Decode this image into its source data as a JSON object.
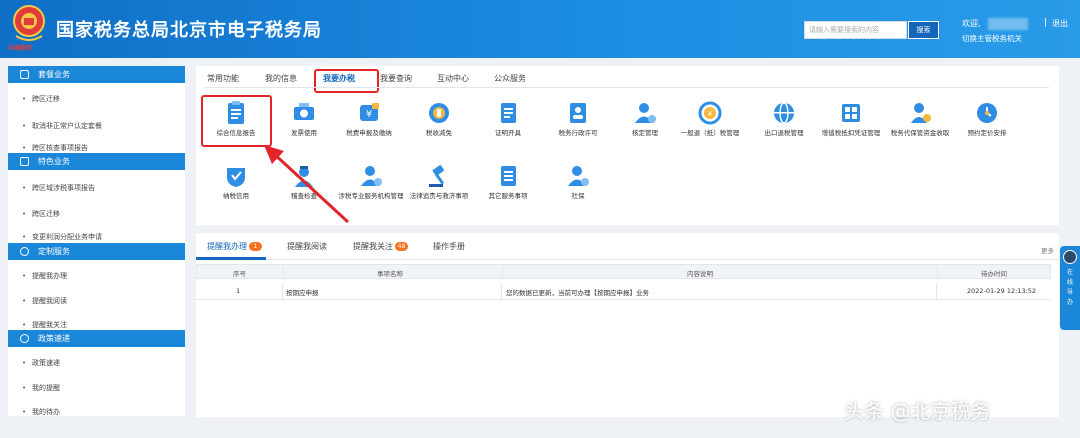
{
  "header": {
    "site_title": "国家税务总局北京市电子税务局",
    "emblem_caption": "中国税务",
    "search_placeholder": "请输入需要搜索的内容",
    "search_button": "搜索",
    "welcome": "欢迎,",
    "switch_label": "切换主管税务机关",
    "separator": "|",
    "logout": "退出"
  },
  "sidebar": {
    "sections": [
      {
        "title": "套餐业务",
        "items": [
          "跨区迁移",
          "取消非正常户认定套餐",
          "跨区核查事项报告"
        ]
      },
      {
        "title": "特色业务",
        "items": [
          "跨区域涉税事项报告",
          "跨区迁移",
          "变更利润分配业务申请"
        ]
      },
      {
        "title": "定制服务",
        "items": [
          "提醒我办理",
          "提醒我阅读",
          "提醒我关注"
        ]
      },
      {
        "title": "政策速递",
        "items": [
          "政策速递",
          "我的提醒",
          "我的待办"
        ]
      }
    ]
  },
  "main_tabs": [
    "常用功能",
    "我的信息",
    "我要办税",
    "我要查询",
    "互动中心",
    "公众服务"
  ],
  "active_tab": "我要办税",
  "tiles_row1": [
    {
      "label": "综合信息报告",
      "icon": "clipboard-icon"
    },
    {
      "label": "发票使用",
      "icon": "ticket-icon"
    },
    {
      "label": "税费申报及缴纳",
      "icon": "yuan-icon"
    },
    {
      "label": "税收减免",
      "icon": "coin-icon"
    },
    {
      "label": "证明开具",
      "icon": "document-icon"
    },
    {
      "label": "税务行政许可",
      "icon": "person-card-icon"
    },
    {
      "label": "核定管理",
      "icon": "user-settings-icon"
    },
    {
      "label": "一般退（抵）税管理",
      "icon": "refund-icon"
    },
    {
      "label": "出口退税管理",
      "icon": "globe-icon"
    },
    {
      "label": "增值税抵扣凭证管理",
      "icon": "grid-icon"
    },
    {
      "label": "税务代保管资金收取",
      "icon": "money-bag-icon"
    },
    {
      "label": "预约定价安排",
      "icon": "clock-icon"
    }
  ],
  "tiles_row2": [
    {
      "label": "纳税信用",
      "icon": "heart-shield-icon"
    },
    {
      "label": "稽查检查",
      "icon": "inspector-icon"
    },
    {
      "label": "涉税专业服务机构管理",
      "icon": "agency-icon"
    },
    {
      "label": "法律追责与救济事项",
      "icon": "gavel-icon"
    },
    {
      "label": "其它服务事项",
      "icon": "list-icon"
    },
    {
      "label": "社保",
      "icon": "social-security-icon"
    }
  ],
  "lower": {
    "tabs": [
      {
        "label": "提醒我办理",
        "badge": "1"
      },
      {
        "label": "提醒我阅读",
        "badge": ""
      },
      {
        "label": "提醒我关注",
        "badge": "48"
      },
      {
        "label": "操作手册",
        "badge": ""
      }
    ],
    "more": "更多",
    "columns": [
      "序号",
      "事项名称",
      "内容说明",
      "待办时间"
    ],
    "rows": [
      {
        "no": "1",
        "name": "按期应申报",
        "desc": "您的数据已更新，当前可办理【按期应申报】业务",
        "time": "2022-01-29 12:13:52"
      }
    ]
  },
  "float_nav": {
    "line1": "在",
    "line2": "线",
    "line3": "导",
    "line4": "办"
  },
  "watermark": "头条 @北京税务",
  "colors": {
    "primary": "#1b87d8",
    "header": "#0f6fc6",
    "highlight": "#e3242b",
    "badge": "#f5731d"
  }
}
